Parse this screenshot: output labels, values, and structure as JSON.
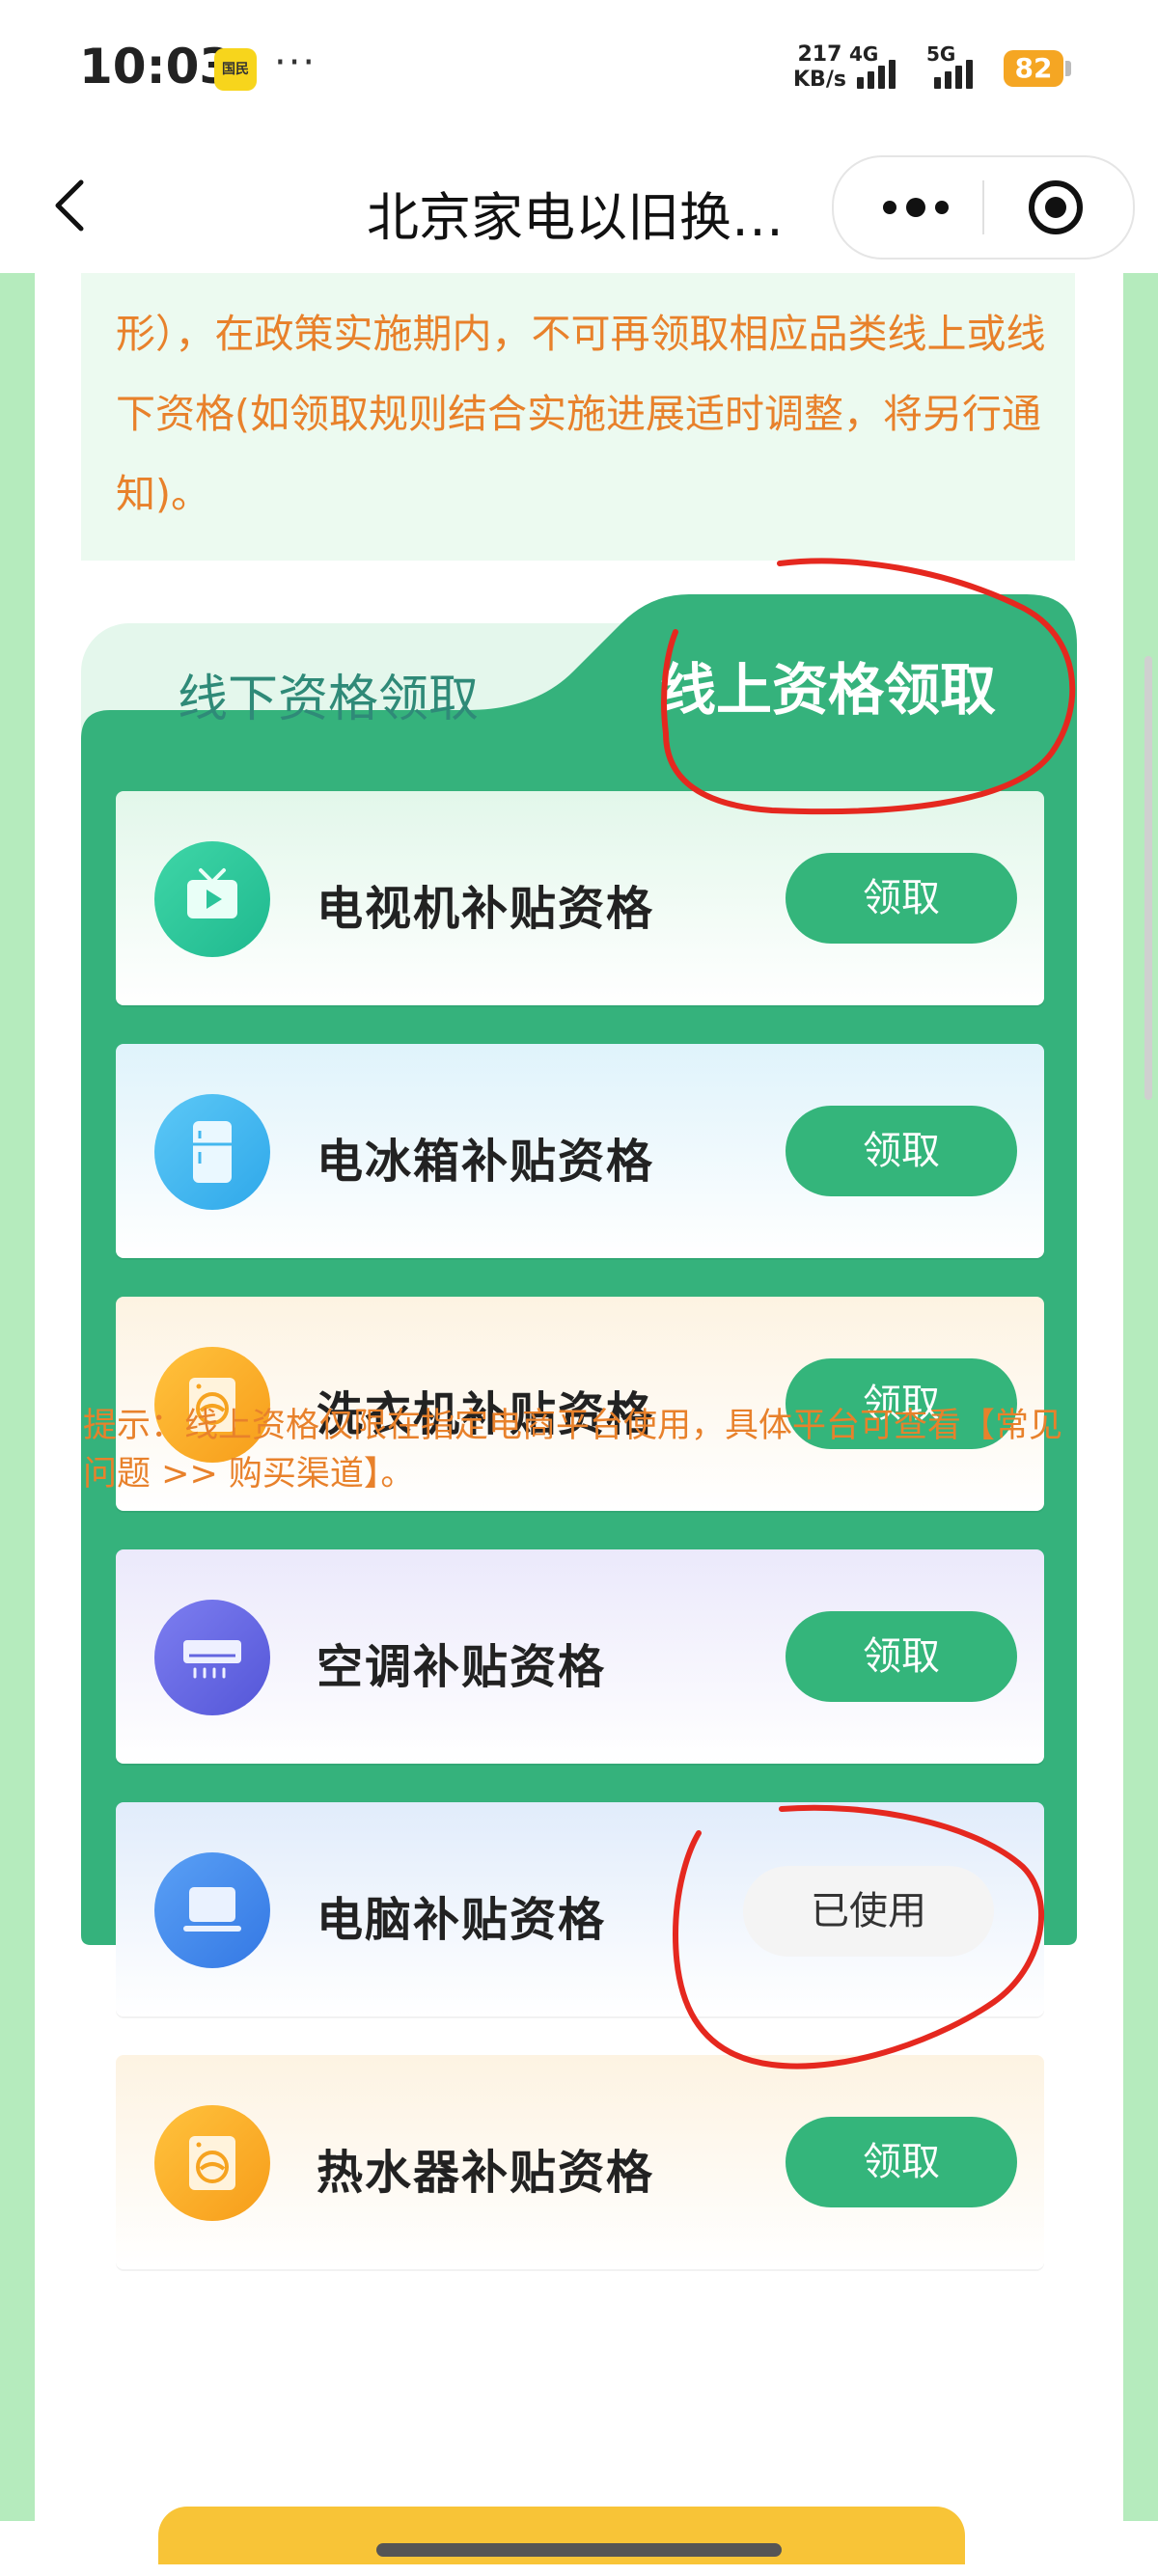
{
  "status_bar": {
    "time": "10:03",
    "app_icon_text": "国民",
    "more_dots": "···",
    "net_speed_value": "217",
    "net_speed_unit": "KB/s",
    "signal_1_label": "4G",
    "signal_2_label": "5G",
    "battery": "82"
  },
  "nav": {
    "title": "北京家电以旧换…",
    "icons": [
      "back-icon",
      "more-icon",
      "target-icon"
    ]
  },
  "notice": {
    "text": "形），在政策实施期内，不可再领取相应品类线上或线下资格(如领取规则结合实施进展适时调整，将另行通知)。"
  },
  "tabs": {
    "offline": "线下资格领取",
    "online": "线上资格领取",
    "active": "online"
  },
  "items": [
    {
      "label": "电视机补贴资格",
      "button": "领取",
      "icon": "tv-icon",
      "status": "claim"
    },
    {
      "label": "电冰箱补贴资格",
      "button": "领取",
      "icon": "fridge-icon",
      "status": "claim"
    },
    {
      "label": "洗衣机补贴资格",
      "button": "领取",
      "icon": "washer-icon",
      "status": "claim"
    },
    {
      "label": "空调补贴资格",
      "button": "领取",
      "icon": "air-conditioner-icon",
      "status": "claim"
    },
    {
      "label": "电脑补贴资格",
      "button": "已使用",
      "icon": "computer-icon",
      "status": "used"
    },
    {
      "label": "热水器补贴资格",
      "button": "领取",
      "icon": "water-heater-icon",
      "status": "claim"
    }
  ],
  "hint": "提示：线上资格仅限在指定电商平台使用，具体平台可查看【常见问题 >> 购买渠道】。",
  "colors": {
    "accent_green": "#34b57b",
    "panel_green": "#35b27c",
    "warning_orange": "#e8812b",
    "annotation_red": "#e5281f"
  }
}
